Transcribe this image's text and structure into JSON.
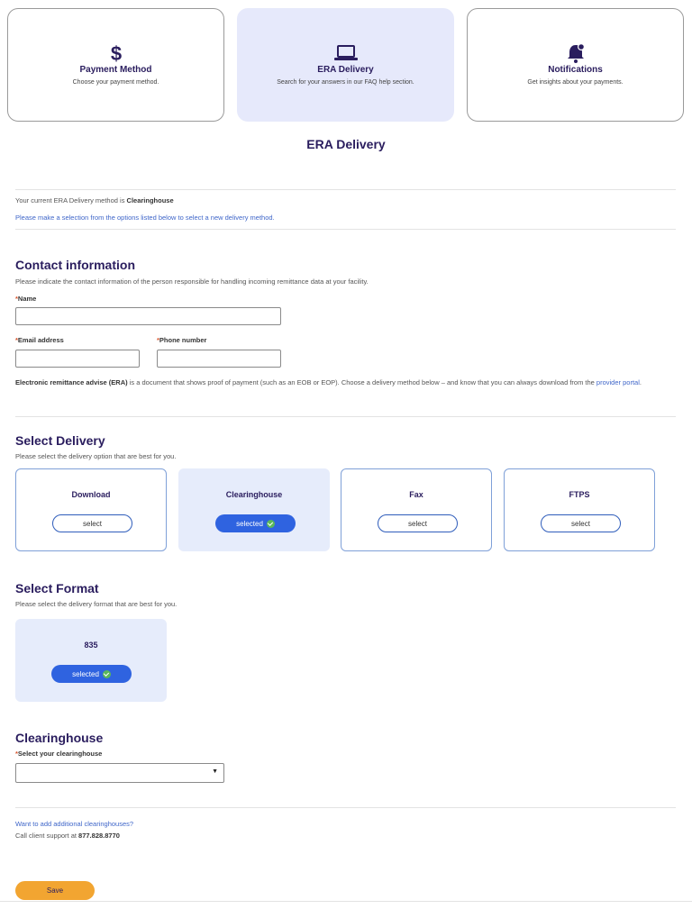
{
  "nav": {
    "cards": [
      {
        "title": "Payment Method",
        "subtitle": "Choose your payment method.",
        "icon": "dollar-icon"
      },
      {
        "title": "ERA Delivery",
        "subtitle": "Search for your answers in our FAQ help section.",
        "icon": "laptop-icon"
      },
      {
        "title": "Notifications",
        "subtitle": "Get insights about your payments.",
        "icon": "bell-icon"
      }
    ],
    "active_index": 1
  },
  "page": {
    "title": "ERA Delivery",
    "current_prefix": "Your current ERA Delivery method is ",
    "current_method": "Clearinghouse",
    "instruction_link": "Please make a selection from the options listed below to select a new delivery method."
  },
  "contact": {
    "heading": "Contact information",
    "desc": "Please indicate the contact information of the person responsible for handling incoming remittance data at your facility.",
    "required_mark": "*",
    "name_label": "Name",
    "name_value": "",
    "email_label": "Email address",
    "email_value": "",
    "phone_label": "Phone number",
    "phone_value": "",
    "era_term": "Electronic remittance advise (ERA)",
    "era_text": " is a document that shows proof of payment (such as an EOB or EOP). Choose a delivery method below – and know that you can always download from the ",
    "portal_link": "provider portal",
    "era_end": "."
  },
  "delivery": {
    "heading": "Select Delivery",
    "desc": "Please select the delivery option that are best for you.",
    "options": [
      {
        "name": "Download",
        "button": "select",
        "selected": false
      },
      {
        "name": "Clearinghouse",
        "button": "selected",
        "selected": true
      },
      {
        "name": "Fax",
        "button": "select",
        "selected": false
      },
      {
        "name": "FTPS",
        "button": "select",
        "selected": false
      }
    ]
  },
  "format": {
    "heading": "Select Format",
    "desc": "Please select the delivery format that are best for you.",
    "option": {
      "name": "835",
      "button": "selected",
      "selected": true
    }
  },
  "clearinghouse": {
    "heading": "Clearinghouse",
    "select_label": "Select your clearinghouse",
    "select_value": "",
    "add_link": "Want to add additional clearinghouses?",
    "support_prefix": "Call client support at ",
    "support_phone": "877.828.8770"
  },
  "actions": {
    "save_label": "Save"
  },
  "colors": {
    "heading": "#2a1d5e",
    "link": "#3f66c9",
    "selected_button": "#2f63e0",
    "selected_card_bg": "#e6ecfb",
    "save_button": "#f2a531",
    "required": "#d9572e",
    "check": "#5bb85a"
  }
}
